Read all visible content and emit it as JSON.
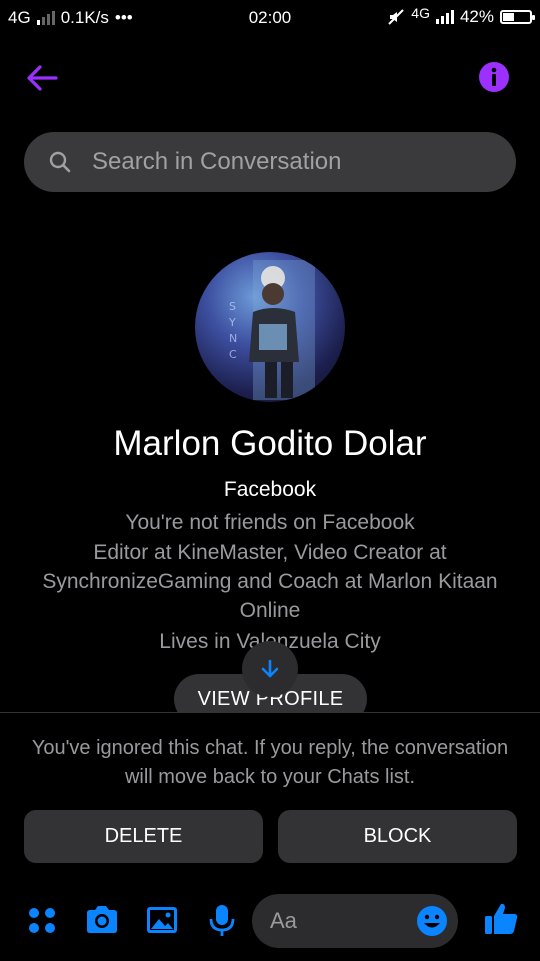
{
  "status_bar": {
    "network_left": "4G",
    "speed": "0.1K/s",
    "more": "•••",
    "time": "02:00",
    "network_right": "4G",
    "battery": "42%",
    "battery_level": 0.42
  },
  "header": {
    "back_icon": "back-arrow-icon",
    "info_icon": "info-icon",
    "accent_color": "#9b30ff"
  },
  "search": {
    "placeholder": "Search in Conversation"
  },
  "profile": {
    "name": "Marlon Godito Dolar",
    "platform": "Facebook",
    "friend_status": "You're not friends on Facebook",
    "work": "Editor at KineMaster, Video Creator at SynchronizeGaming and Coach at Marlon Kitaan Online",
    "lives": "Lives in Valenzuela City",
    "view_profile_label": "VIEW PROFILE"
  },
  "notice": {
    "ignored_text": "You've ignored this chat. If you reply, the conversation will move back to your Chats list."
  },
  "actions": {
    "delete_label": "DELETE",
    "block_label": "BLOCK"
  },
  "composer": {
    "placeholder": "Aa",
    "icon_color": "#0a84ff",
    "icons": [
      "menu-dots-icon",
      "camera-icon",
      "gallery-icon",
      "microphone-icon",
      "emoji-icon",
      "thumbs-up-icon"
    ]
  }
}
